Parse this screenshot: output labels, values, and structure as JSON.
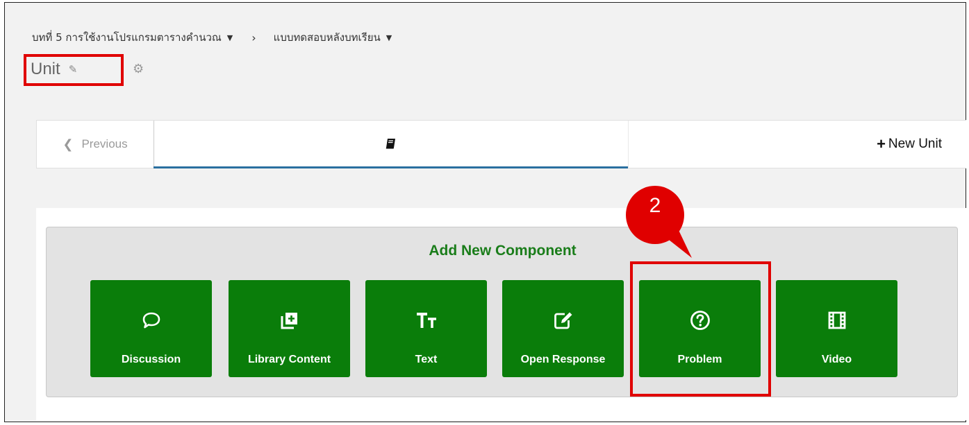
{
  "breadcrumb": {
    "section": "บทที่ 5 การใช้งานโปรแกรมตารางคำนวณ",
    "separator": "›",
    "subsection": "แบบทดสอบหลังบทเรียน"
  },
  "unit": {
    "title": "Unit"
  },
  "unit_nav": {
    "previous_label": "Previous",
    "new_unit_label": "New Unit"
  },
  "add_component": {
    "heading": "Add New Component",
    "buttons": [
      {
        "label": "Discussion",
        "icon": "speech-bubble-icon"
      },
      {
        "label": "Library Content",
        "icon": "library-add-icon"
      },
      {
        "label": "Text",
        "icon": "text-format-icon"
      },
      {
        "label": "Open Response",
        "icon": "edit-square-icon"
      },
      {
        "label": "Problem",
        "icon": "question-circle-icon"
      },
      {
        "label": "Video",
        "icon": "film-icon"
      }
    ]
  },
  "annotation": {
    "step_number": "2",
    "color": "#e00000"
  },
  "colors": {
    "button_green": "#0a7d0a",
    "heading_green": "#1a7d1a",
    "nav_accent": "#2a6fa0"
  }
}
